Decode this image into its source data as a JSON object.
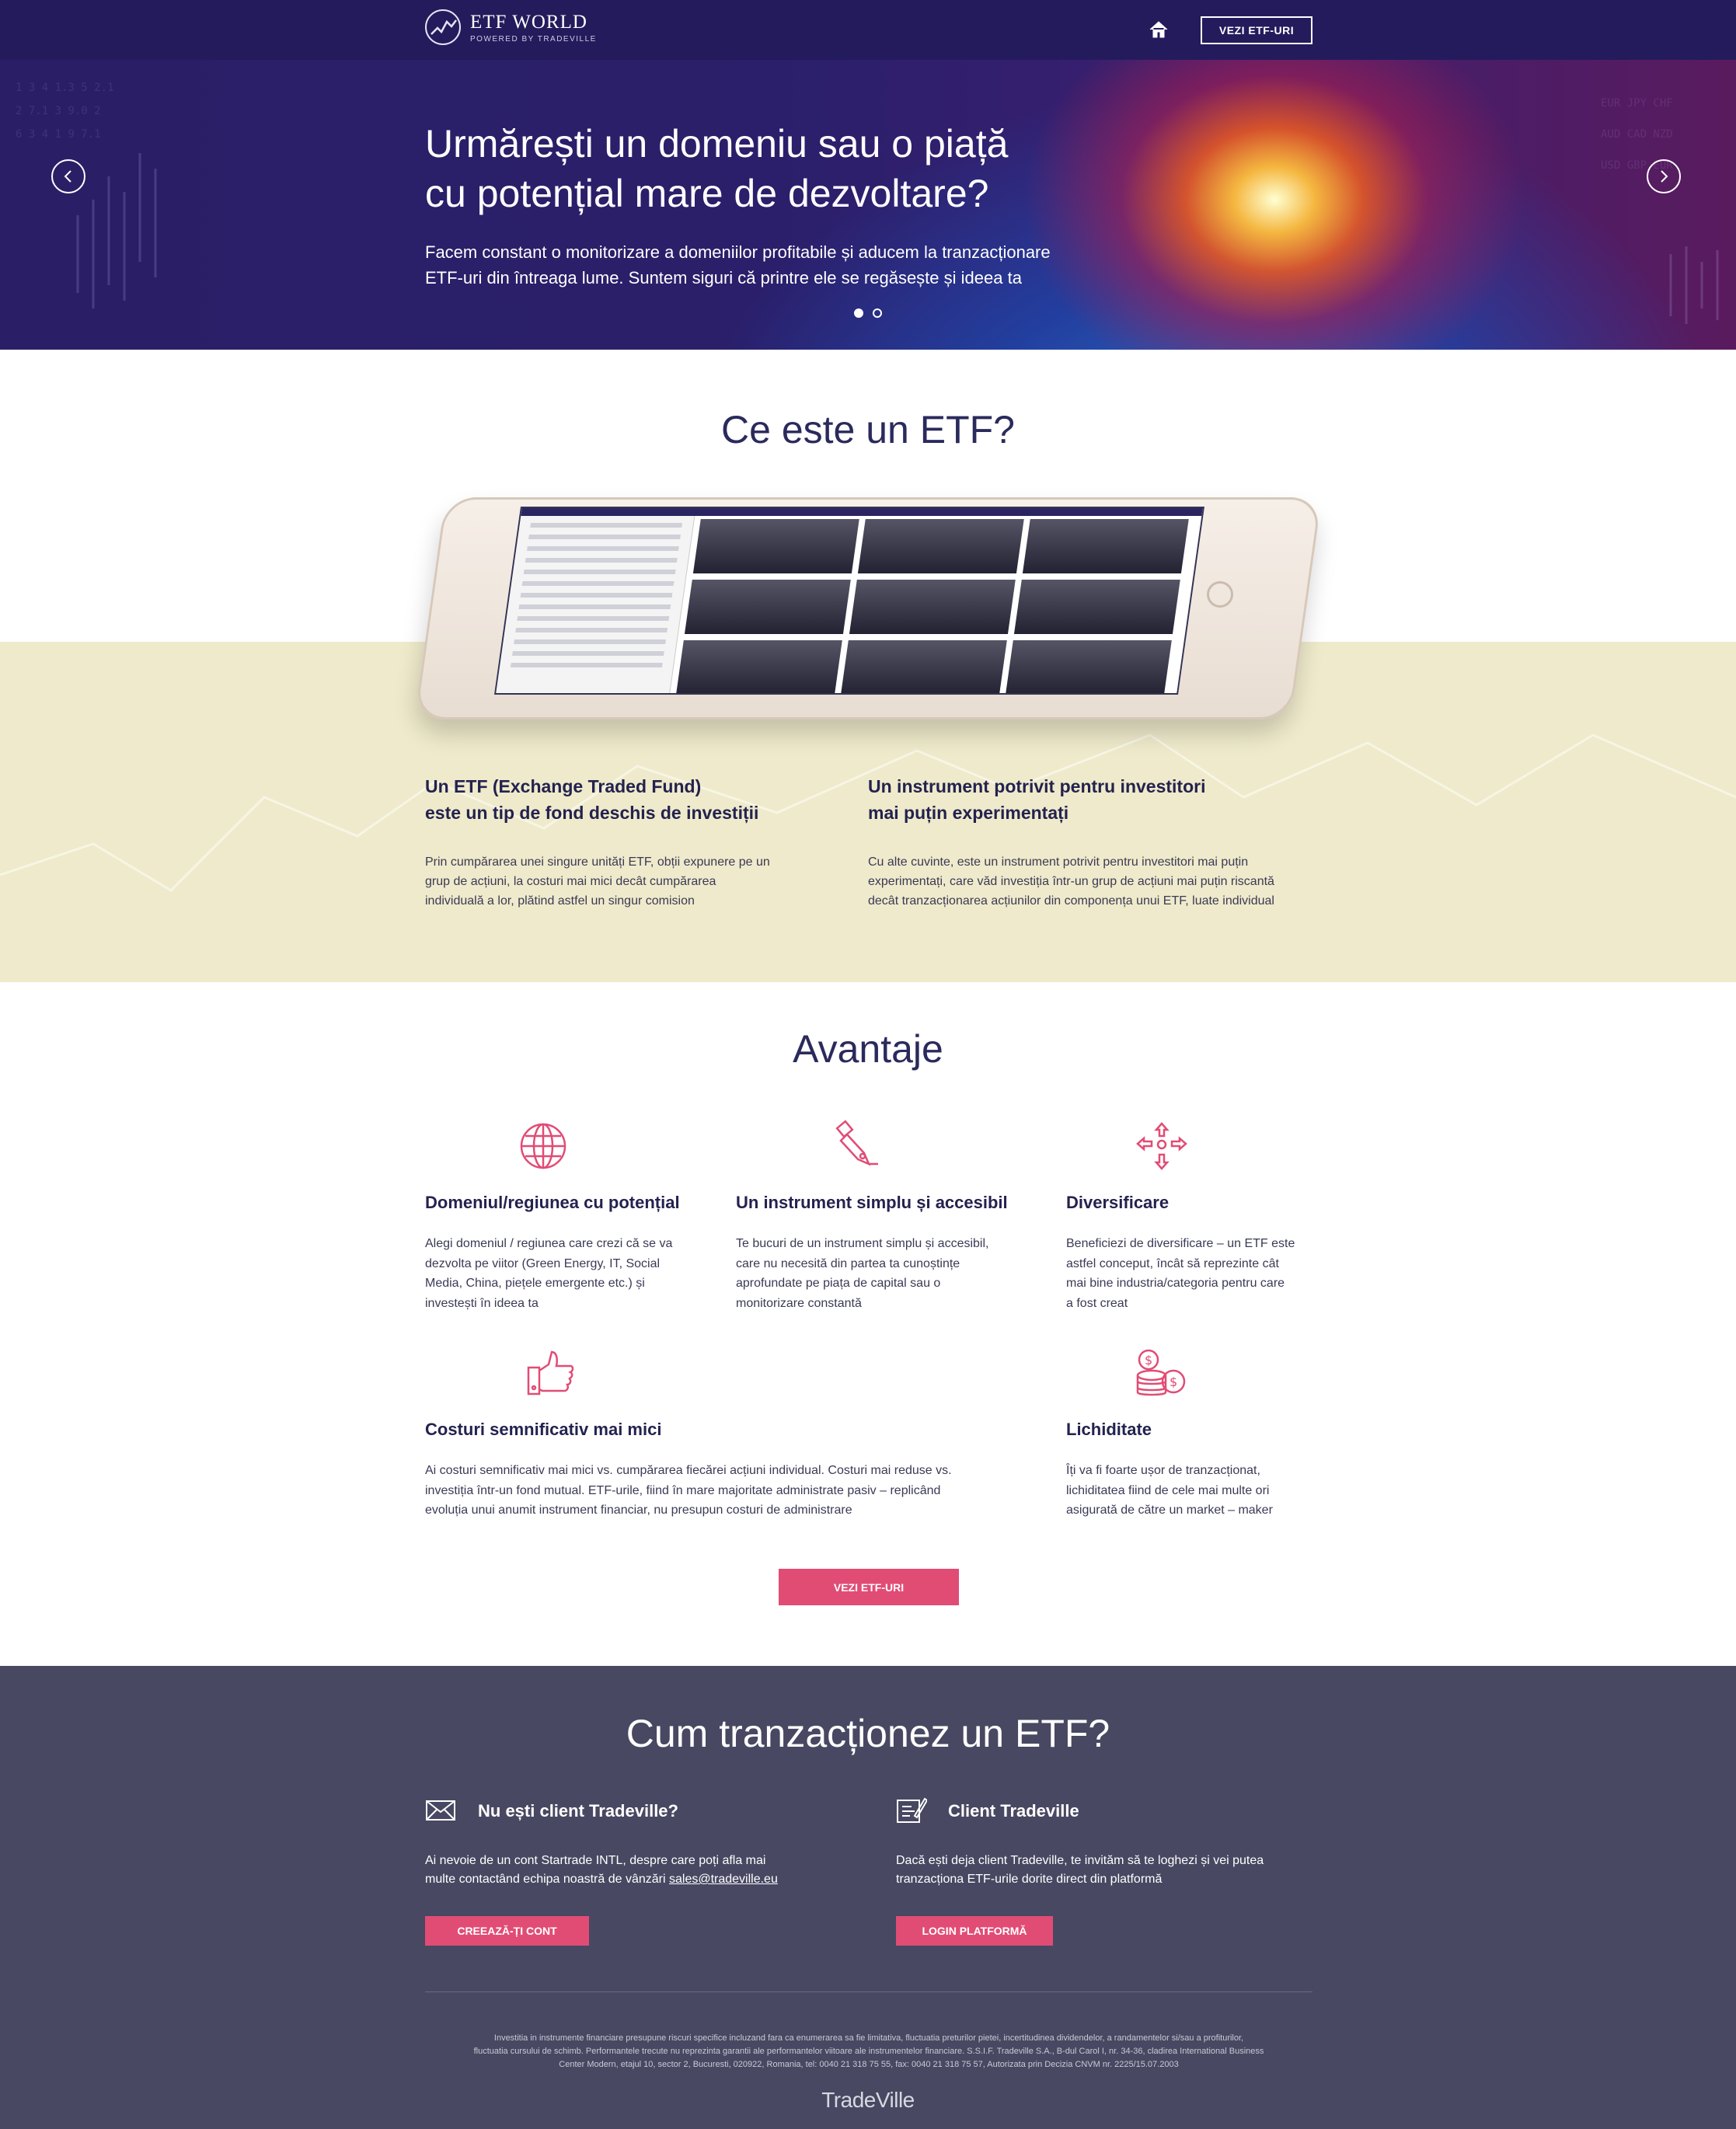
{
  "header": {
    "logo_title": "ETF WORLD",
    "logo_subtitle": "POWERED BY TRADEVILLE",
    "home_icon": "home-icon",
    "nav_button": "VEZI ETF-URI"
  },
  "hero": {
    "title_line1": "Urmărești un domeniu sau o piață",
    "title_line2": "cu potențial mare de dezvoltare?",
    "text_line1": "Facem constant o monitorizare a domeniilor profitabile și aducem la tranzacționare",
    "text_line2": "ETF-uri din întreaga lume. Suntem siguri că printre ele se regăsește și ideea ta",
    "slides": 2,
    "active_slide": 1
  },
  "what_is": {
    "title": "Ce este un ETF?",
    "left_title_line1": "Un ETF (Exchange Traded Fund)",
    "left_title_line2": "este un tip de fond deschis de investiții",
    "left_text_line1": "Prin cumpărarea unei singure unități ETF, obții expunere pe un",
    "left_text_line2": "grup de acțiuni, la costuri mai mici decât cumpărarea",
    "left_text_line3": "individuală a lor, plătind astfel un singur comision",
    "right_title_line1": "Un instrument potrivit pentru investitori",
    "right_title_line2": "mai puțin experimentați",
    "right_text_line1": "Cu alte cuvinte, este un instrument potrivit pentru investitori mai puțin",
    "right_text_line2": "experimentați, care văd investiția într-un grup de acțiuni mai puțin riscantă",
    "right_text_line3": "decât tranzacționarea acțiunilor din componența unui ETF, luate individual"
  },
  "advantages": {
    "title": "Avantaje",
    "items": [
      {
        "icon": "globe-icon",
        "title": "Domeniul/regiunea cu potențial",
        "lines": [
          "Alegi domeniul / regiunea care crezi că se va",
          "dezvolta pe viitor (Green Energy, IT, Social",
          "Media, China, piețele emergente etc.) și",
          "investești în ideea ta"
        ]
      },
      {
        "icon": "pen-nib-icon",
        "title": "Un instrument simplu și accesibil",
        "lines": [
          "Te bucuri de un instrument simplu și accesibil,",
          "care nu necesită din partea ta cunoștințe",
          "aprofundate pe piața de capital sau o",
          "monitorizare constantă"
        ]
      },
      {
        "icon": "diversify-arrows-icon",
        "title": "Diversificare",
        "lines": [
          "Beneficiezi de diversificare – un ETF este",
          "astfel conceput, încât să reprezinte cât",
          "mai bine industria/categoria pentru care",
          "a fost creat"
        ]
      },
      {
        "icon": "thumbs-up-icon",
        "title": "Costuri semnificativ mai mici",
        "lines": [
          "Ai costuri semnificativ mai mici vs. cumpărarea fiecărei acțiuni individual. Costuri mai reduse vs.",
          "investiția într-un fond mutual. ETF-urile, fiind în mare majoritate administrate pasiv – replicând",
          "evoluția unui anumit instrument financiar, nu presupun costuri de administrare"
        ]
      },
      {
        "icon": "coins-icon",
        "title": "Lichiditate",
        "lines": [
          "Îți va fi foarte ușor de tranzacționat,",
          "lichiditatea fiind de cele mai multe ori",
          "asigurată de către un market – maker"
        ]
      }
    ],
    "cta": "VEZI ETF-URI"
  },
  "how_to": {
    "title": "Cum tranzacționez un ETF?",
    "left_icon": "envelope-icon",
    "left_title": "Nu ești client Tradeville?",
    "left_text_line1": "Ai nevoie de un cont Startrade INTL, despre care poți afla mai",
    "left_text_line2": "multe contactând echipa noastră de vânzări",
    "left_email": "sales@tradeville.eu",
    "left_button": "CREEAZĂ-ȚI CONT",
    "right_icon": "document-sign-icon",
    "right_title": "Client Tradeville",
    "right_text_line1": "Dacă ești deja client Tradeville, te invităm să te loghezi și vei putea",
    "right_text_line2": "tranzacționa ETF-urile dorite direct din platformă",
    "right_button": "LOGIN PLATFORMĂ"
  },
  "footer": {
    "disclaimer_line1": "Investitia in instrumente financiare presupune riscuri specifice incluzand fara ca enumerarea sa fie limitativa, fluctuatia preturilor pietei, incertitudinea dividendelor, a randamentelor si/sau a profiturilor,",
    "disclaimer_line2": "fluctuatia cursului de schimb. Performantele trecute nu reprezinta garantii ale performantelor viitoare ale instrumentelor financiare. S.S.I.F. Tradeville S.A., B-dul Carol I, nr. 34-36, cladirea International Business",
    "disclaimer_line3": "Center Modern, etajul 10, sector 2, Bucuresti, 020922, Romania, tel: 0040 21 318 75 55, fax: 0040 21 318 75 57, Autorizata prin Decizia CNVM nr. 2225/15.07.2003",
    "brand": "TradeVille"
  },
  "colors": {
    "header_bg": "#241b5c",
    "accent_pink": "#e14c75",
    "band_bg": "#efeacb",
    "dark_bg": "#484862",
    "heading": "#2a2a5c"
  }
}
